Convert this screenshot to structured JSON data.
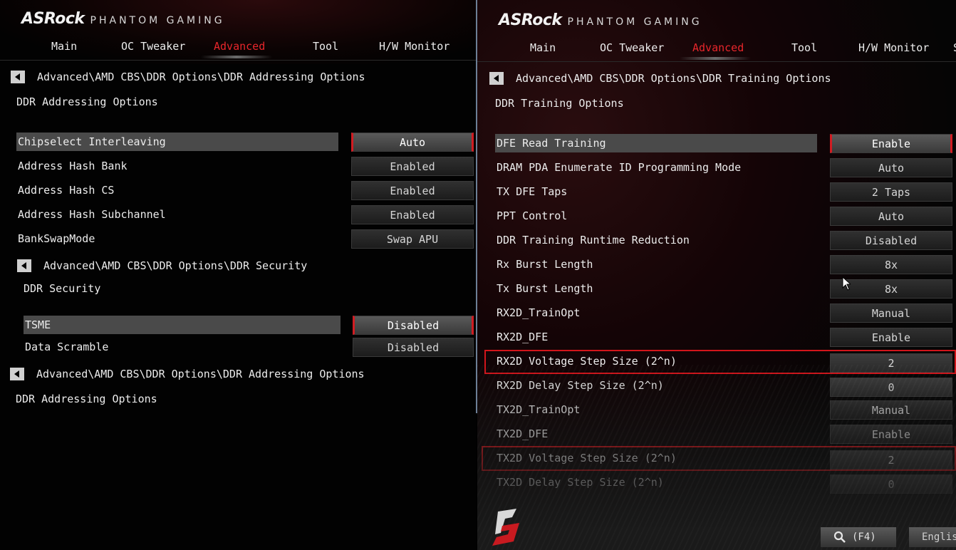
{
  "left": {
    "logo": {
      "brand": "ASRock",
      "sub": "PHANTOM GAMING"
    },
    "tabs": [
      "Main",
      "OC Tweaker",
      "Advanced",
      "Tool",
      "H/W Monitor"
    ],
    "breadcrumb1": "Advanced\\AMD CBS\\DDR Options\\DDR Addressing Options",
    "title1": "DDR Addressing Options",
    "options1": [
      {
        "label": "Chipselect Interleaving",
        "value": "Auto"
      },
      {
        "label": "Address Hash Bank",
        "value": "Enabled"
      },
      {
        "label": "Address Hash CS",
        "value": "Enabled"
      },
      {
        "label": "Address Hash Subchannel",
        "value": "Enabled"
      },
      {
        "label": "BankSwapMode",
        "value": "Swap APU"
      }
    ],
    "breadcrumb2": "Advanced\\AMD CBS\\DDR Options\\DDR Security",
    "title2": "DDR Security",
    "options2": [
      {
        "label": "TSME",
        "value": "Disabled"
      },
      {
        "label": "Data Scramble",
        "value": "Disabled"
      }
    ],
    "breadcrumb3": "Advanced\\AMD CBS\\DDR Options\\DDR Addressing Options",
    "title3": "DDR Addressing Options"
  },
  "right": {
    "logo": {
      "brand": "ASRock",
      "sub": "PHANTOM GAMING"
    },
    "tabs": [
      "Main",
      "OC Tweaker",
      "Advanced",
      "Tool",
      "H/W Monitor",
      "S"
    ],
    "breadcrumb": "Advanced\\AMD CBS\\DDR Options\\DDR Training Options",
    "title": "DDR Training Options",
    "options": [
      {
        "label": "DFE Read Training",
        "value": "Enable"
      },
      {
        "label": "DRAM PDA Enumerate ID Programming Mode",
        "value": "Auto"
      },
      {
        "label": "TX DFE Taps",
        "value": "2 Taps"
      },
      {
        "label": "PPT Control",
        "value": "Auto"
      },
      {
        "label": "DDR Training Runtime Reduction",
        "value": "Disabled"
      },
      {
        "label": "Rx Burst Length",
        "value": "8x"
      },
      {
        "label": "Tx Burst Length",
        "value": "8x"
      },
      {
        "label": "RX2D_TrainOpt",
        "value": "Manual"
      },
      {
        "label": "RX2D_DFE",
        "value": "Enable"
      },
      {
        "label": "RX2D Voltage Step Size (2^n)",
        "value": "2"
      },
      {
        "label": "RX2D Delay Step Size (2^n)",
        "value": "0"
      },
      {
        "label": "TX2D_TrainOpt",
        "value": "Manual"
      },
      {
        "label": "TX2D_DFE",
        "value": "Enable"
      },
      {
        "label": "TX2D Voltage Step Size (2^n)",
        "value": "2"
      },
      {
        "label": "TX2D Delay Step Size (2^n)",
        "value": "0"
      }
    ],
    "search_label": "(F4)",
    "language_label": "Englis"
  },
  "colors": {
    "accent": "#e8262b",
    "highlight_box": "#d3151b",
    "selected_row": "#4a4a4a"
  }
}
